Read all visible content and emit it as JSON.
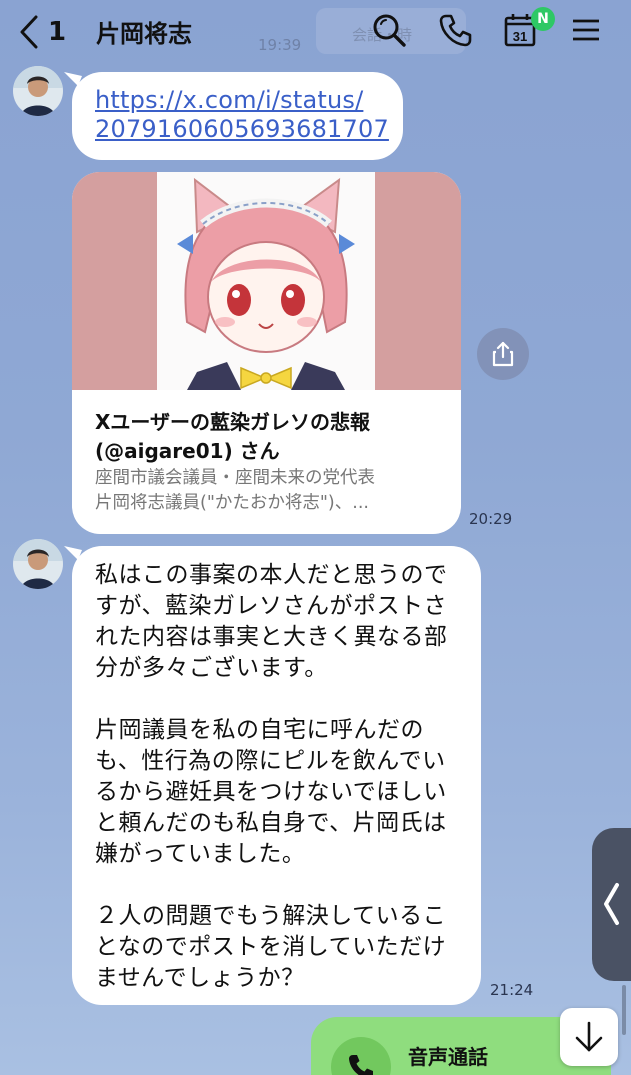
{
  "header": {
    "back_count": "1",
    "title": "片岡将志",
    "ghost_time": "19:39",
    "ghost_search": "会話・時",
    "calendar_day": "31",
    "calendar_badge": "N"
  },
  "icons": {
    "back": "chevron-left-icon",
    "search": "search-icon",
    "call": "phone-icon",
    "calendar": "calendar-icon",
    "menu": "menu-icon",
    "share": "share-icon",
    "side": "chevron-left-icon",
    "down": "arrow-down-icon"
  },
  "messages": {
    "link": {
      "url_line1": "https://x.com/i/status/",
      "url_line2": "2079160605693681707"
    },
    "preview": {
      "title": "Xユーザーの藍染ガレソの悲報\n(@aigare01) さん",
      "desc_line1": "座間市議会議員・座間未来の党代表",
      "desc_line2": "片岡将志議員(\"かたおか将志\")、...",
      "time": "20:29"
    },
    "text": {
      "body": "私はこの事案の本人だと思うので\nすが、藍染ガレソさんがポストさ\nれた内容は事実と大きく異なる部\n分が多々ございます。\n\n片岡議員を私の自宅に呼んだの\nも、性行為の際にピルを飲んでい\nるから避妊具をつけないでほしい\nと頼んだのも私自身で、片岡氏は\n嫌がっていました。\n\n２人の問題でもう解決しているこ\nとなのでポストを消していただけ\nませんでしょうか？",
      "time": "21:24"
    },
    "call": {
      "label": "音声通話"
    }
  },
  "colors": {
    "background": "#8fa8d4",
    "link": "#3a5fc8",
    "call_bubble": "#8fdd7e",
    "badge": "#2ec865"
  }
}
